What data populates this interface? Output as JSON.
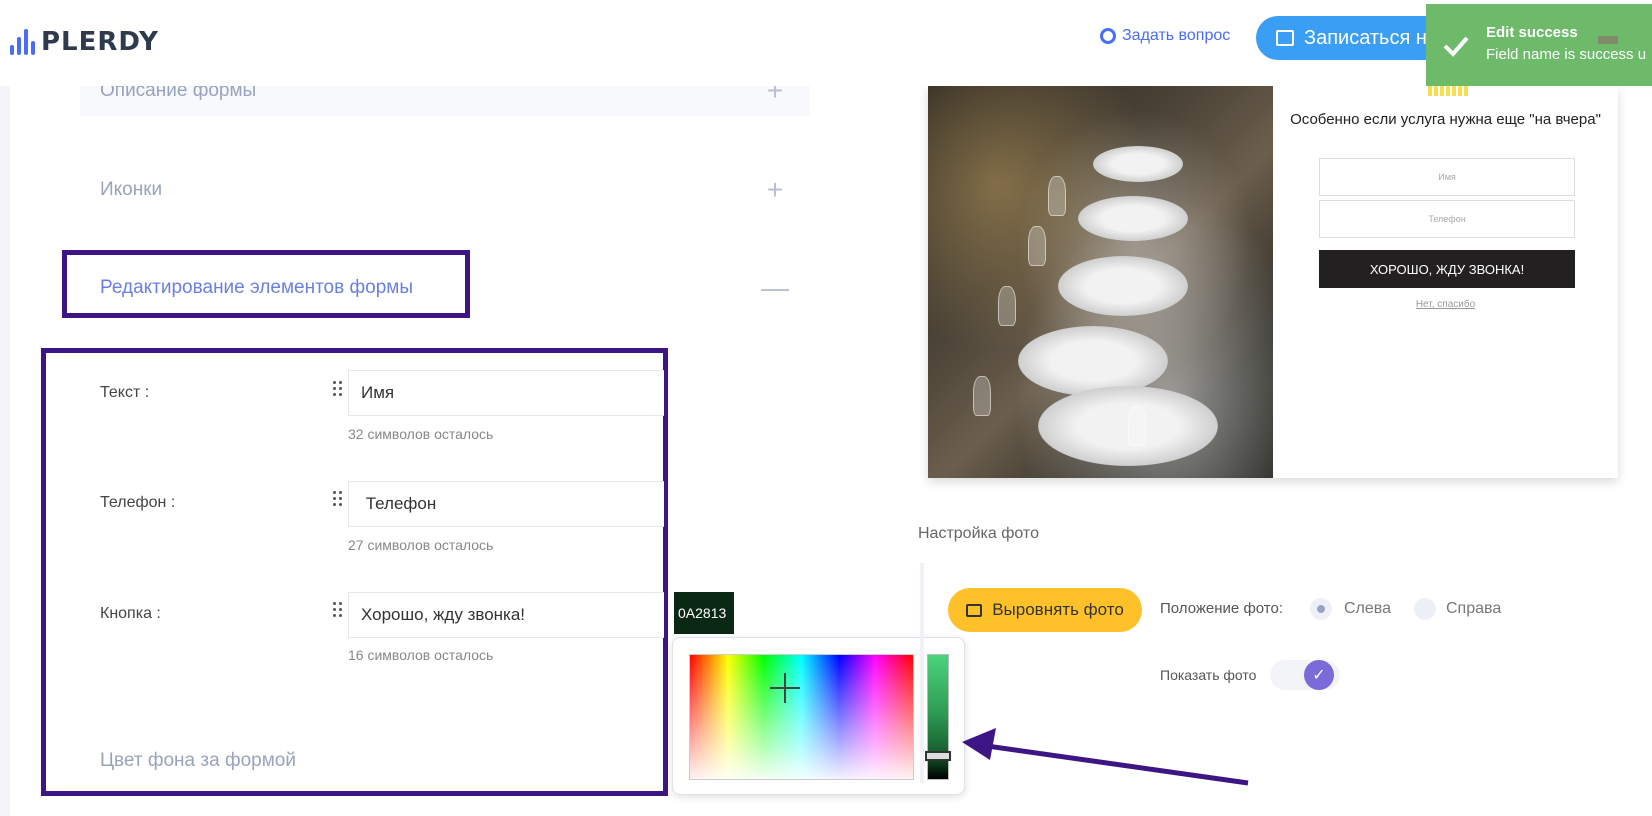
{
  "header": {
    "logo_text": "PLERDY",
    "ask_question": "Задать вопрос",
    "demo_button": "Записаться на демо"
  },
  "toast": {
    "title": "Edit success",
    "message": "Field name is success u"
  },
  "accordion": {
    "items": [
      {
        "label": "Описание формы",
        "sign": "+"
      },
      {
        "label": "Иконки",
        "sign": "+"
      },
      {
        "label": "Редактирование элементов формы",
        "sign": "—"
      }
    ]
  },
  "form_fields": [
    {
      "label": "Текст :",
      "value": "Имя",
      "hint": "32 символов осталось"
    },
    {
      "label": "Телефон :",
      "value": " Телефон",
      "hint": "27 символов осталось"
    },
    {
      "label": "Кнопка :",
      "value": "Хорошо, жду звонка!",
      "hint": "16 символов осталось"
    }
  ],
  "bg_color_label": "Цвет фона за формой",
  "color_picker": {
    "hex_value": "0A2813",
    "selected_color": "#0A2813"
  },
  "preview": {
    "title": "Особенно если услуга нужна еще \"на вчера\"",
    "name_placeholder": "Имя",
    "phone_placeholder": "Телефон",
    "button": "ХОРОШО, ЖДУ ЗВОНКА!",
    "no_thanks": "Нет, спасибо"
  },
  "photo_settings": {
    "title": "Настройка фото",
    "align_button": "Выровнять фото",
    "position_label": "Положение фото:",
    "left_option": "Слева",
    "right_option": "Справа",
    "selected_position": "Слева",
    "show_photo_label": "Показать фото",
    "show_photo": true
  },
  "colors": {
    "accent": "#4a6cf7",
    "highlight_border": "#3d1585",
    "toast_bg": "#6dbb6a",
    "align_button_bg": "#fec12a",
    "toggle_knob": "#7a6bd8"
  }
}
